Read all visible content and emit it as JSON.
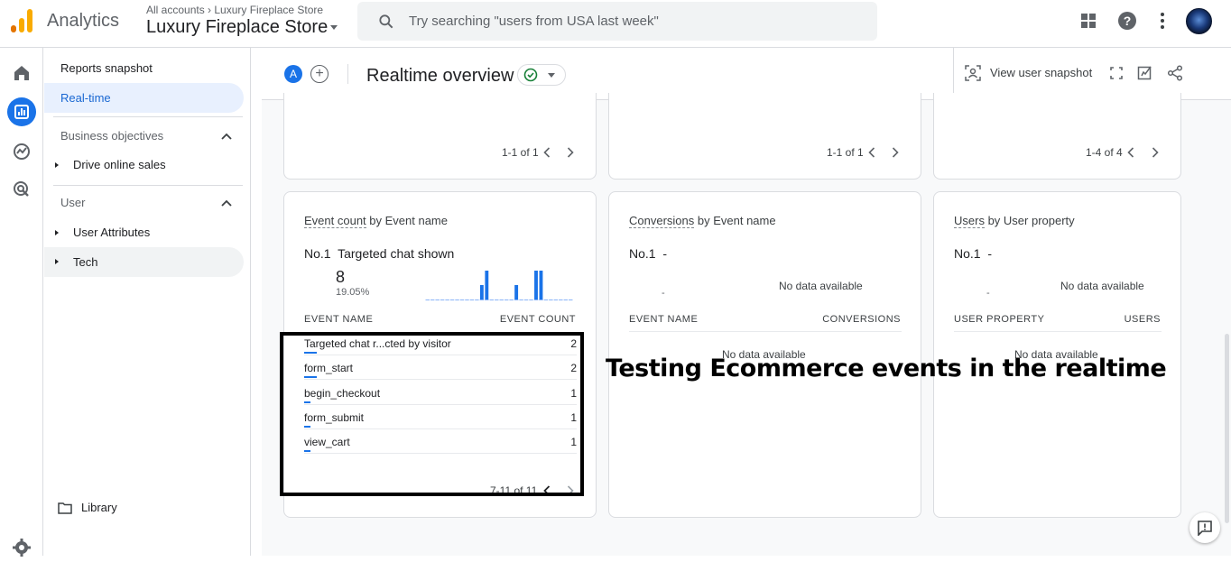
{
  "header": {
    "app_name": "Analytics",
    "account_crumb": "All accounts › Luxury Fireplace Store",
    "account_name": "Luxury Fireplace Store",
    "search_placeholder": "Try searching \"users from USA last week\""
  },
  "nav": {
    "reports_snapshot": "Reports snapshot",
    "realtime": "Real-time",
    "business_objectives": "Business objectives",
    "drive_online_sales": "Drive online sales",
    "user_section": "User",
    "user_attributes": "User Attributes",
    "tech": "Tech",
    "library": "Library"
  },
  "subbar": {
    "compare_letter": "A",
    "add_symbol": "+",
    "title": "Realtime overview",
    "view_user_snapshot": "View user snapshot"
  },
  "top_cards": [
    {
      "pager": "1-1 of 1"
    },
    {
      "pager": "1-1 of 1"
    },
    {
      "pager": "1-4 of 4"
    }
  ],
  "event_card": {
    "title_prefix": "Event count",
    "title_suffix": " by Event name",
    "rank_label": "No.1",
    "top_name": "Targeted chat shown",
    "top_value": "8",
    "top_pct": "19.05%",
    "col_left": "EVENT NAME",
    "col_right": "EVENT COUNT",
    "rows": [
      {
        "name": "Targeted chat r...cted by visitor",
        "count": "2",
        "share": 0.2
      },
      {
        "name": "form_start",
        "count": "2",
        "share": 0.2
      },
      {
        "name": "begin_checkout",
        "count": "1",
        "share": 0.1
      },
      {
        "name": "form_submit",
        "count": "1",
        "share": 0.1
      },
      {
        "name": "view_cart",
        "count": "1",
        "share": 0.1
      }
    ],
    "pager": "7-11 of 11",
    "sparkline": [
      0,
      0,
      0,
      0,
      0,
      0,
      0,
      0,
      0,
      0,
      0,
      3,
      6,
      0,
      0,
      0,
      0,
      0,
      3,
      0,
      0,
      0,
      6,
      6,
      0,
      0,
      0,
      0,
      0,
      0
    ]
  },
  "conversions_card": {
    "title_prefix": "Conversions",
    "title_suffix": " by Event name",
    "rank_label": "No.1",
    "top_name": "-",
    "top_value": "-",
    "chart_empty": "No data available",
    "col_left": "EVENT NAME",
    "col_right": "CONVERSIONS",
    "table_empty": "No data available"
  },
  "users_card": {
    "title_prefix": "Users",
    "title_suffix": " by User property",
    "rank_label": "No.1",
    "top_name": "-",
    "top_value": "-",
    "chart_empty": "No data available",
    "col_left": "USER PROPERTY",
    "col_right": "USERS",
    "table_empty": "No data available"
  },
  "annotation": {
    "caption": "Testing Ecommerce events in the realtime"
  },
  "colors": {
    "accent": "#1a73e8",
    "logo_orange": "#f9ab00",
    "logo_dark": "#e37400",
    "check_green": "#188038"
  }
}
